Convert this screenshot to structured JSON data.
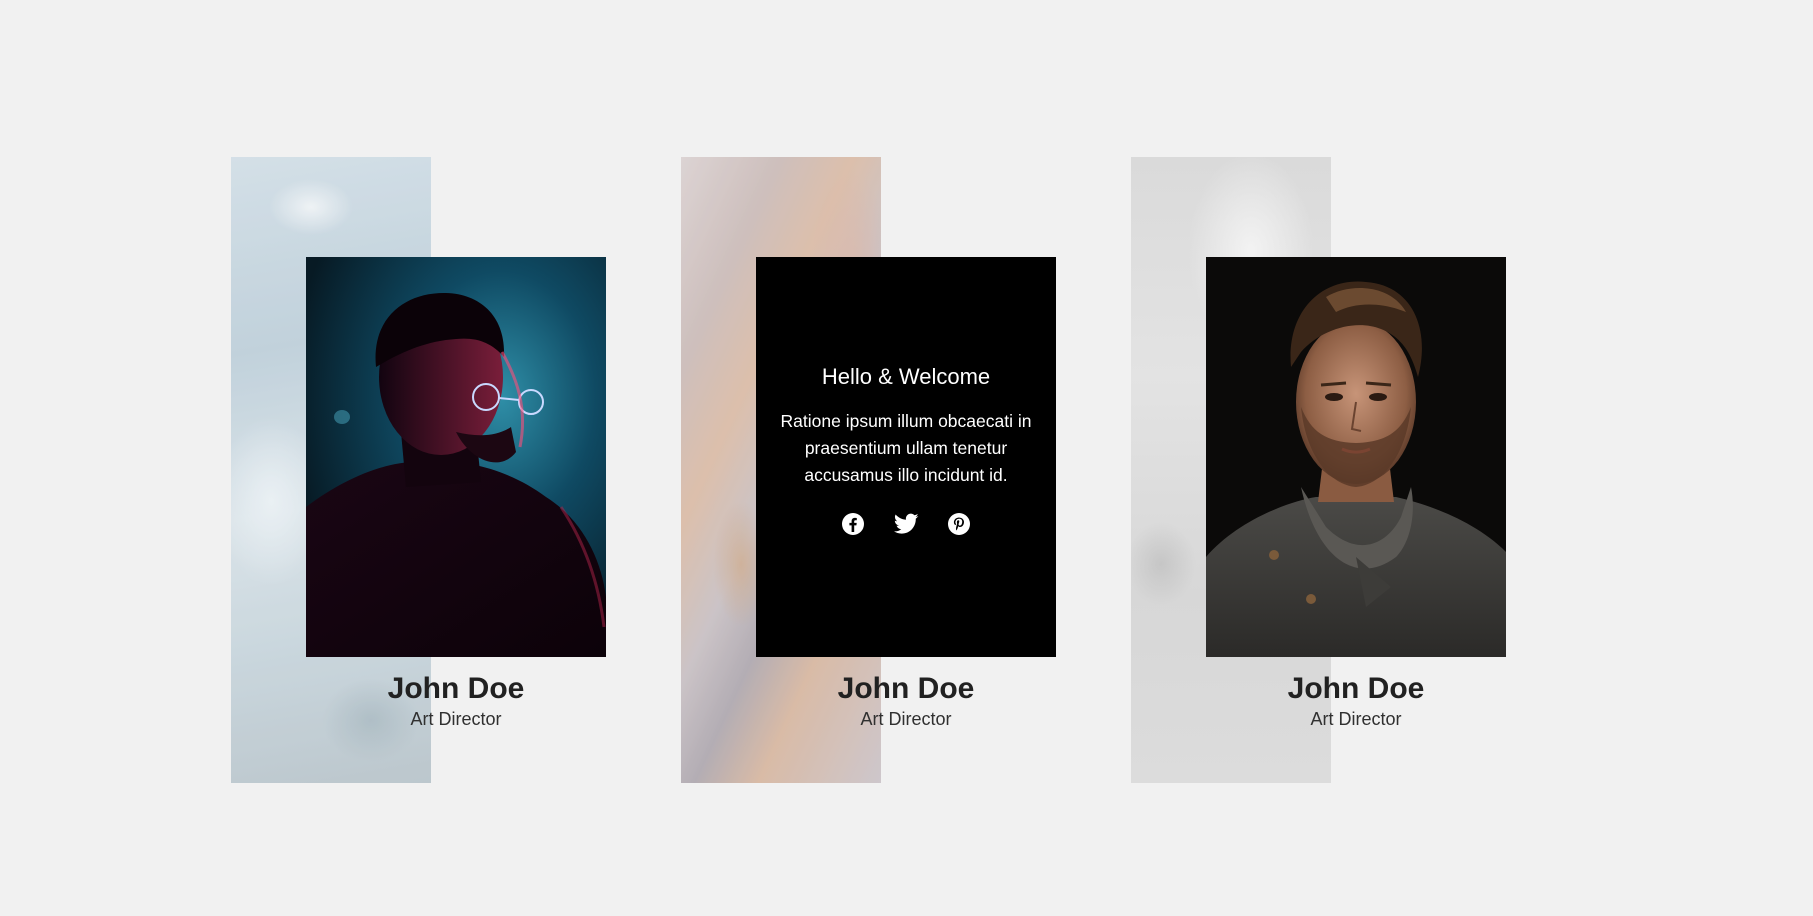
{
  "team": {
    "members": [
      {
        "name": "John Doe",
        "role": "Art Director"
      },
      {
        "name": "John Doe",
        "role": "Art Director"
      },
      {
        "name": "John Doe",
        "role": "Art Director"
      }
    ],
    "hover_card": {
      "title": "Hello & Welcome",
      "text": "Ratione ipsum illum obcaecati in praesentium ullam tenetur accusamus illo incidunt id.",
      "social_icons": [
        "facebook-icon",
        "twitter-icon",
        "pinterest-icon"
      ]
    }
  },
  "colors": {
    "page_background": "#f1f1f1",
    "overlay_background": "#000000",
    "name_text": "#212121"
  }
}
